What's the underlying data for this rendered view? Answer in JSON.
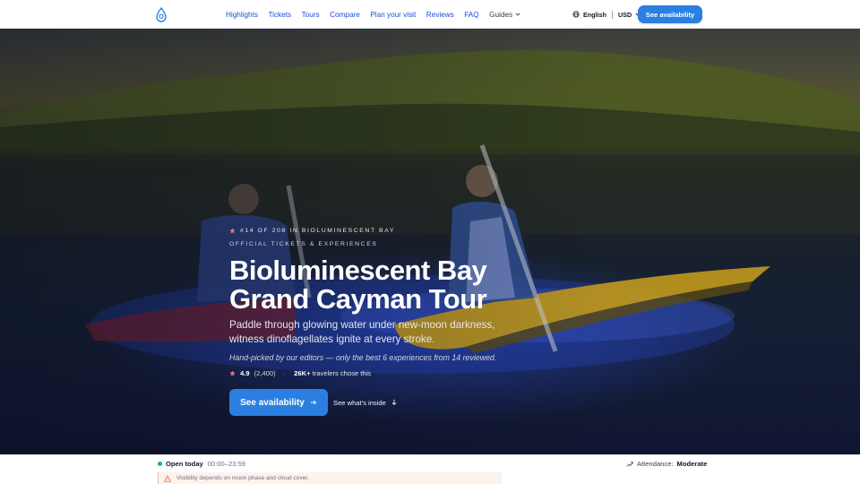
{
  "header": {
    "logo_icon": "water-drop-icon",
    "nav": [
      "Highlights",
      "Tickets",
      "Tours",
      "Compare",
      "Plan your visit",
      "Reviews",
      "FAQ"
    ],
    "guides_label": "Guides",
    "language": "English",
    "currency": "USD",
    "cta_label": "See availability"
  },
  "hero": {
    "rank": "#14 OF 208 IN BIOLUMINESCENT BAY",
    "eyebrow": "OFFICIAL TICKETS & EXPERIENCES",
    "title_line1": "Bioluminescent Bay",
    "title_line2": "Grand Cayman Tour",
    "subtitle": "Paddle through glowing water under new-moon darkness, witness dinoflagellates ignite at every stroke.",
    "editor_note": "Hand-picked by our editors — only the best 6 experiences from 14 reviewed.",
    "rating": "4.9",
    "review_count": "(2,400)",
    "travelers_count": "26K+",
    "travelers_text": "travelers chose this",
    "cta_primary": "See availability",
    "cta_secondary": "See what's inside"
  },
  "infobar": {
    "open_label": "Open today",
    "hours": "00:00–23:59",
    "attendance_label": "Attendance:",
    "attendance_value": "Moderate",
    "notice": "Visibility depends on moon phase and cloud cover."
  },
  "colors": {
    "accent": "#2b7fe0",
    "nav_link": "#1d4ed8",
    "star": "#f87171",
    "open_dot": "#10b981",
    "notice_bg": "#fdf2ec"
  }
}
